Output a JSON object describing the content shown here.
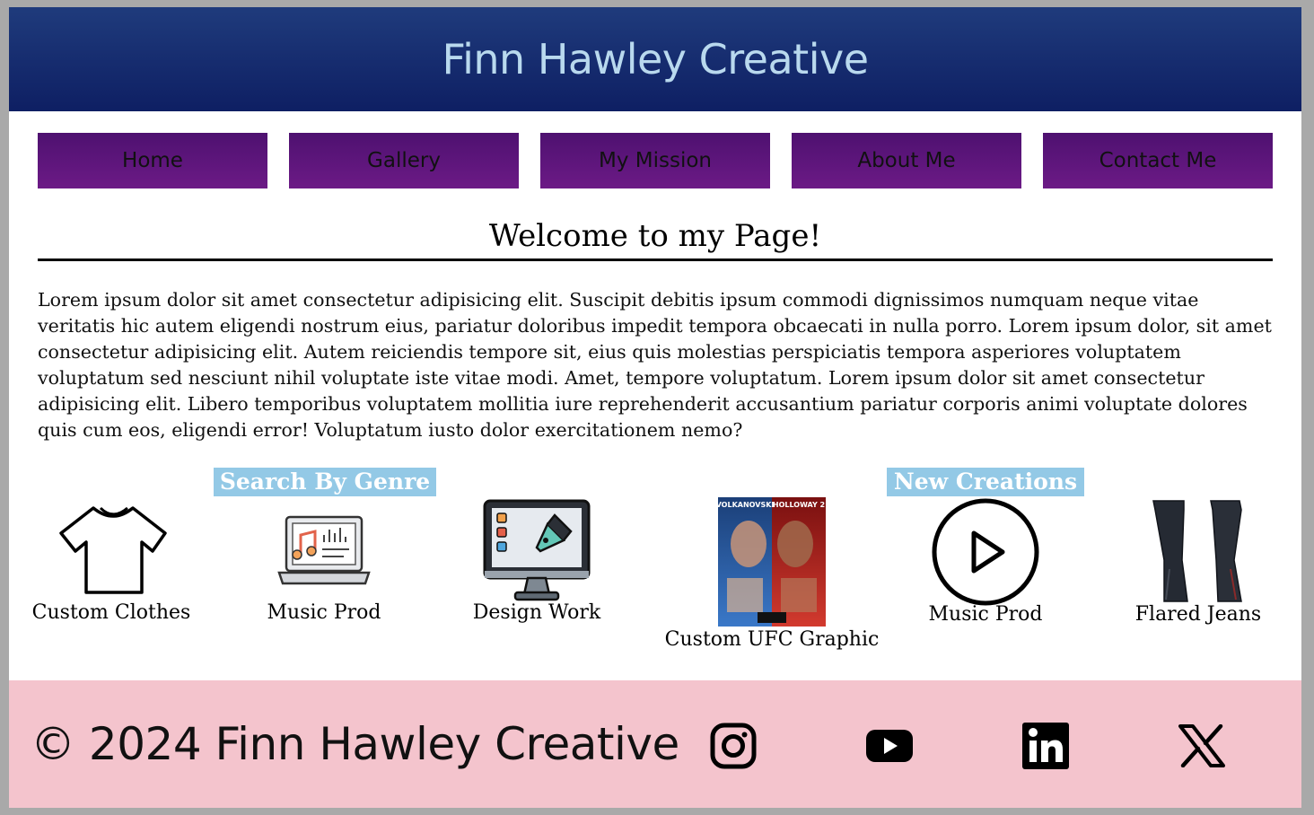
{
  "header": {
    "title": "Finn Hawley Creative"
  },
  "nav": {
    "items": [
      {
        "label": "Home"
      },
      {
        "label": "Gallery"
      },
      {
        "label": "My Mission"
      },
      {
        "label": "About Me"
      },
      {
        "label": "Contact Me"
      }
    ]
  },
  "welcome": {
    "heading": "Welcome to my Page!",
    "body": "Lorem ipsum dolor sit amet consectetur adipisicing elit. Suscipit debitis ipsum commodi dignissimos numquam neque vitae veritatis hic autem eligendi nostrum eius, pariatur doloribus impedit tempora obcaecati in nulla porro. Lorem ipsum dolor, sit amet consectetur adipisicing elit. Autem reiciendis tempore sit, eius quis molestias perspiciatis tempora asperiores voluptatem voluptatum sed nesciunt nihil voluptate iste vitae modi. Amet, tempore voluptatum. Lorem ipsum dolor sit amet consectetur adipisicing elit. Libero temporibus voluptatem mollitia iure reprehenderit accusantium pariatur corporis animi voluptate dolores quis cum eos, eligendi error! Voluptatum iusto dolor exercitationem nemo?"
  },
  "sections": {
    "genre_label": "Search By Genre",
    "new_label": "New Creations"
  },
  "gallery": [
    {
      "caption": "Custom Clothes",
      "icon": "tshirt-icon"
    },
    {
      "caption": "Music Prod",
      "icon": "laptop-music-icon"
    },
    {
      "caption": "Design Work",
      "icon": "monitor-design-icon"
    },
    {
      "caption": "Custom UFC Graphic",
      "icon": "ufc-poster-image",
      "poster_text": [
        "VOLKANOVSKI",
        "HOLLOWAY 2"
      ]
    },
    {
      "caption": "Music Prod",
      "icon": "play-circle-icon"
    },
    {
      "caption": "Flared Jeans",
      "icon": "jeans-image"
    }
  ],
  "footer": {
    "copyright": "© 2024 Finn Hawley Creative",
    "social": [
      {
        "name": "instagram-icon"
      },
      {
        "name": "youtube-icon"
      },
      {
        "name": "linkedin-icon"
      },
      {
        "name": "x-icon"
      }
    ]
  },
  "colors": {
    "header_bg": "#1a3275",
    "title_text": "#b9d9ee",
    "nav_bg": "#5e167b",
    "label_bg": "#93c9e6",
    "footer_bg": "#f4c4cd"
  }
}
